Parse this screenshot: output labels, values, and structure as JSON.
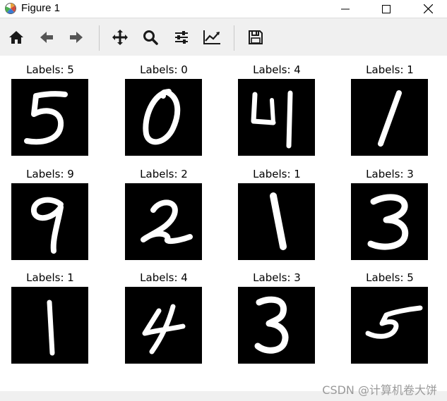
{
  "window": {
    "title": "Figure 1",
    "controls": [
      "minimize",
      "maximize",
      "close"
    ]
  },
  "toolbar": {
    "buttons": [
      {
        "icon": "home-icon"
      },
      {
        "icon": "back-arrow-icon"
      },
      {
        "icon": "forward-arrow-icon"
      },
      {
        "icon": "pan-icon"
      },
      {
        "icon": "zoom-icon"
      },
      {
        "icon": "configure-subplots-icon"
      },
      {
        "icon": "edit-axis-icon"
      },
      {
        "icon": "save-icon"
      }
    ]
  },
  "subplots": [
    {
      "title": "Labels: 5",
      "digit": "5"
    },
    {
      "title": "Labels: 0",
      "digit": "0"
    },
    {
      "title": "Labels: 4",
      "digit": "4"
    },
    {
      "title": "Labels: 1",
      "digit": "1"
    },
    {
      "title": "Labels: 9",
      "digit": "9"
    },
    {
      "title": "Labels: 2",
      "digit": "2"
    },
    {
      "title": "Labels: 1",
      "digit": "1"
    },
    {
      "title": "Labels: 3",
      "digit": "3"
    },
    {
      "title": "Labels: 1",
      "digit": "1"
    },
    {
      "title": "Labels: 4",
      "digit": "4"
    },
    {
      "title": "Labels: 3",
      "digit": "3"
    },
    {
      "title": "Labels: 5",
      "digit": "5"
    }
  ],
  "watermark": "CSDN @计算机卷大饼",
  "colors": {
    "image_bg": "#000000",
    "digit_stroke": "#ffffff",
    "toolbar_bg": "#f0f0f0"
  }
}
